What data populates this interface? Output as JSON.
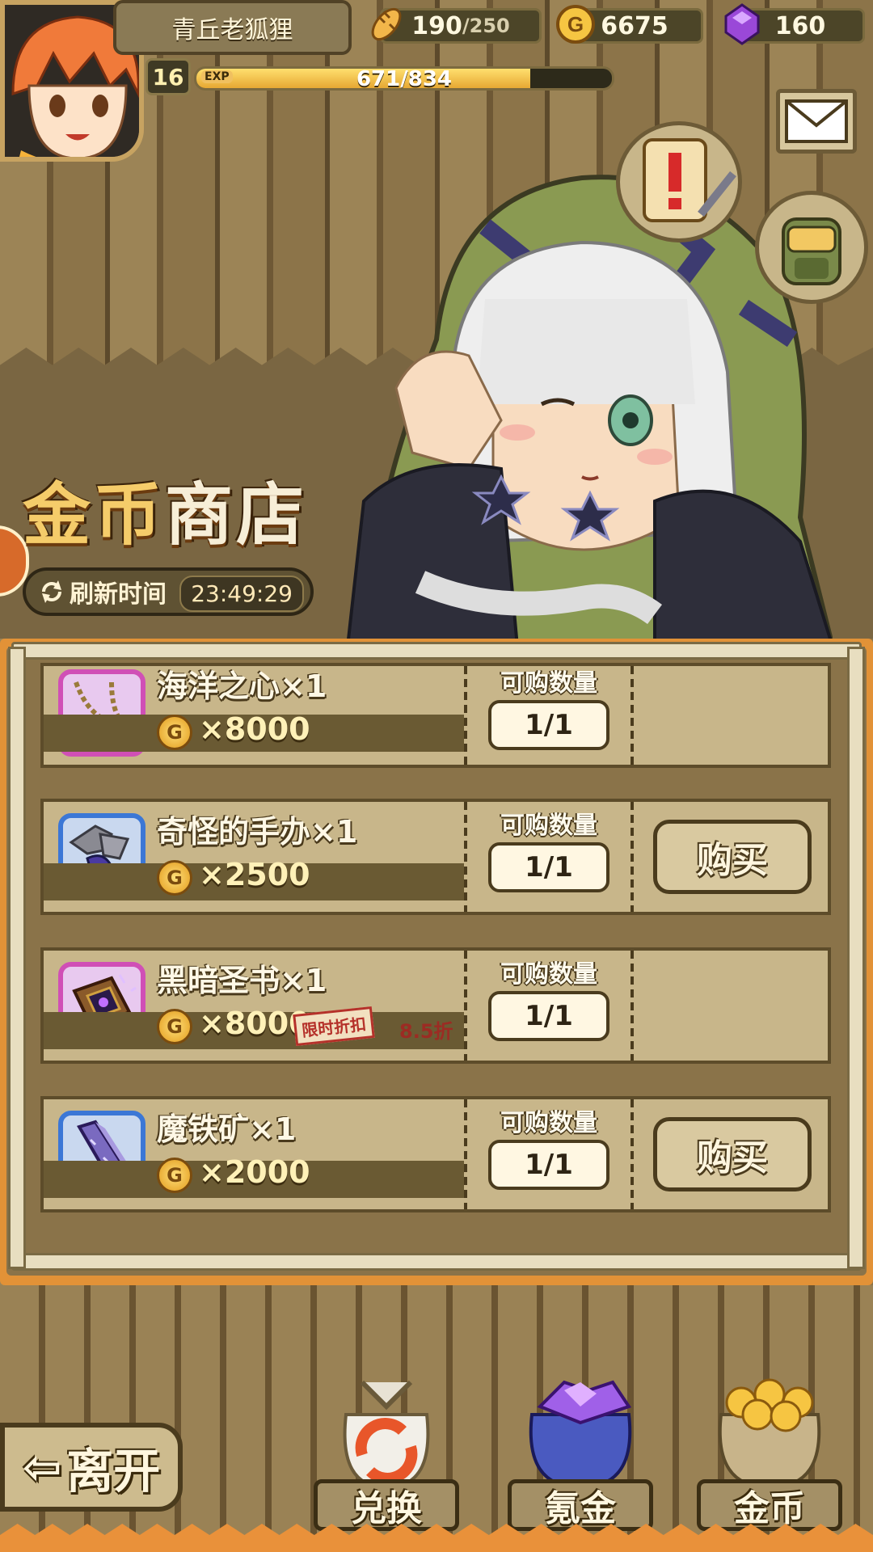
{
  "player": {
    "name": "青丘老狐狸",
    "level": "16",
    "exp_tag": "EXP",
    "exp_text": "671/834",
    "exp_fraction": 0.804
  },
  "resources": {
    "stamina": "190",
    "stamina_max": "/250",
    "gold": "6675",
    "gems": "160"
  },
  "shop": {
    "title_gold": "金币",
    "title_shop": "商店",
    "refresh_label": "刷新时间",
    "refresh_time": "23:49:29",
    "qty_label": "可购数量",
    "buy_label": "购买",
    "coin_symbol": "G",
    "items": [
      {
        "name": "海洋之心×1",
        "price": "×8000",
        "qty": "1/1",
        "count": "1",
        "frame": "purple",
        "icon": "necklace-icon"
      },
      {
        "name": "奇怪的手办×1",
        "price": "×2500",
        "qty": "1/1",
        "count": "1",
        "frame": "blue",
        "icon": "figurine-icon"
      },
      {
        "name": "黑暗圣书×1",
        "price": "×8000",
        "qty": "1/1",
        "count": "1",
        "frame": "purple",
        "icon": "dark-book-icon",
        "discount_label": "限时折扣",
        "discount_rate": "8.5折"
      },
      {
        "name": "魔铁矿×1",
        "price": "×2000",
        "qty": "1/1",
        "count": "1",
        "frame": "blue",
        "icon": "ore-icon"
      }
    ]
  },
  "nav": {
    "leave": "离开",
    "exchange": "兑换",
    "krypton": "氪金",
    "gold": "金币"
  },
  "colors": {
    "accent_orange": "#e29237",
    "gold": "#f5cc6a",
    "purple_frame": "#d04fb6",
    "blue_frame": "#3b77d6"
  }
}
